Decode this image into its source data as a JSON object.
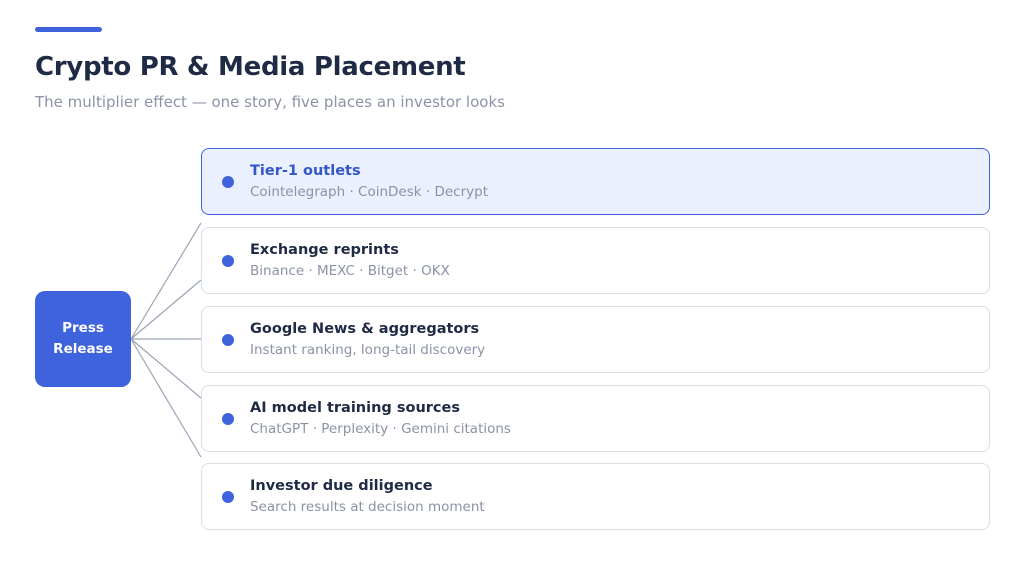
{
  "header": {
    "title": "Crypto PR & Media Placement",
    "subtitle": "The multiplier effect — one story, five places an investor looks"
  },
  "source": {
    "line1": "Press",
    "line2": "Release"
  },
  "channels": [
    {
      "title": "Tier-1 outlets",
      "description": "Cointelegraph · CoinDesk · Decrypt",
      "highlighted": true
    },
    {
      "title": "Exchange reprints",
      "description": "Binance · MEXC · Bitget · OKX",
      "highlighted": false
    },
    {
      "title": "Google News & aggregators",
      "description": "Instant ranking, long-tail discovery",
      "highlighted": false
    },
    {
      "title": "AI model training sources",
      "description": "ChatGPT · Perplexity · Gemini citations",
      "highlighted": false
    },
    {
      "title": "Investor due diligence",
      "description": "Search results at decision moment",
      "highlighted": false
    }
  ],
  "colors": {
    "accent": "#3f63dd",
    "highlight_background": "#eaf0fd",
    "title_text": "#1f2a44",
    "muted_text": "#8a93a6",
    "connector": "#9aa4b6"
  }
}
